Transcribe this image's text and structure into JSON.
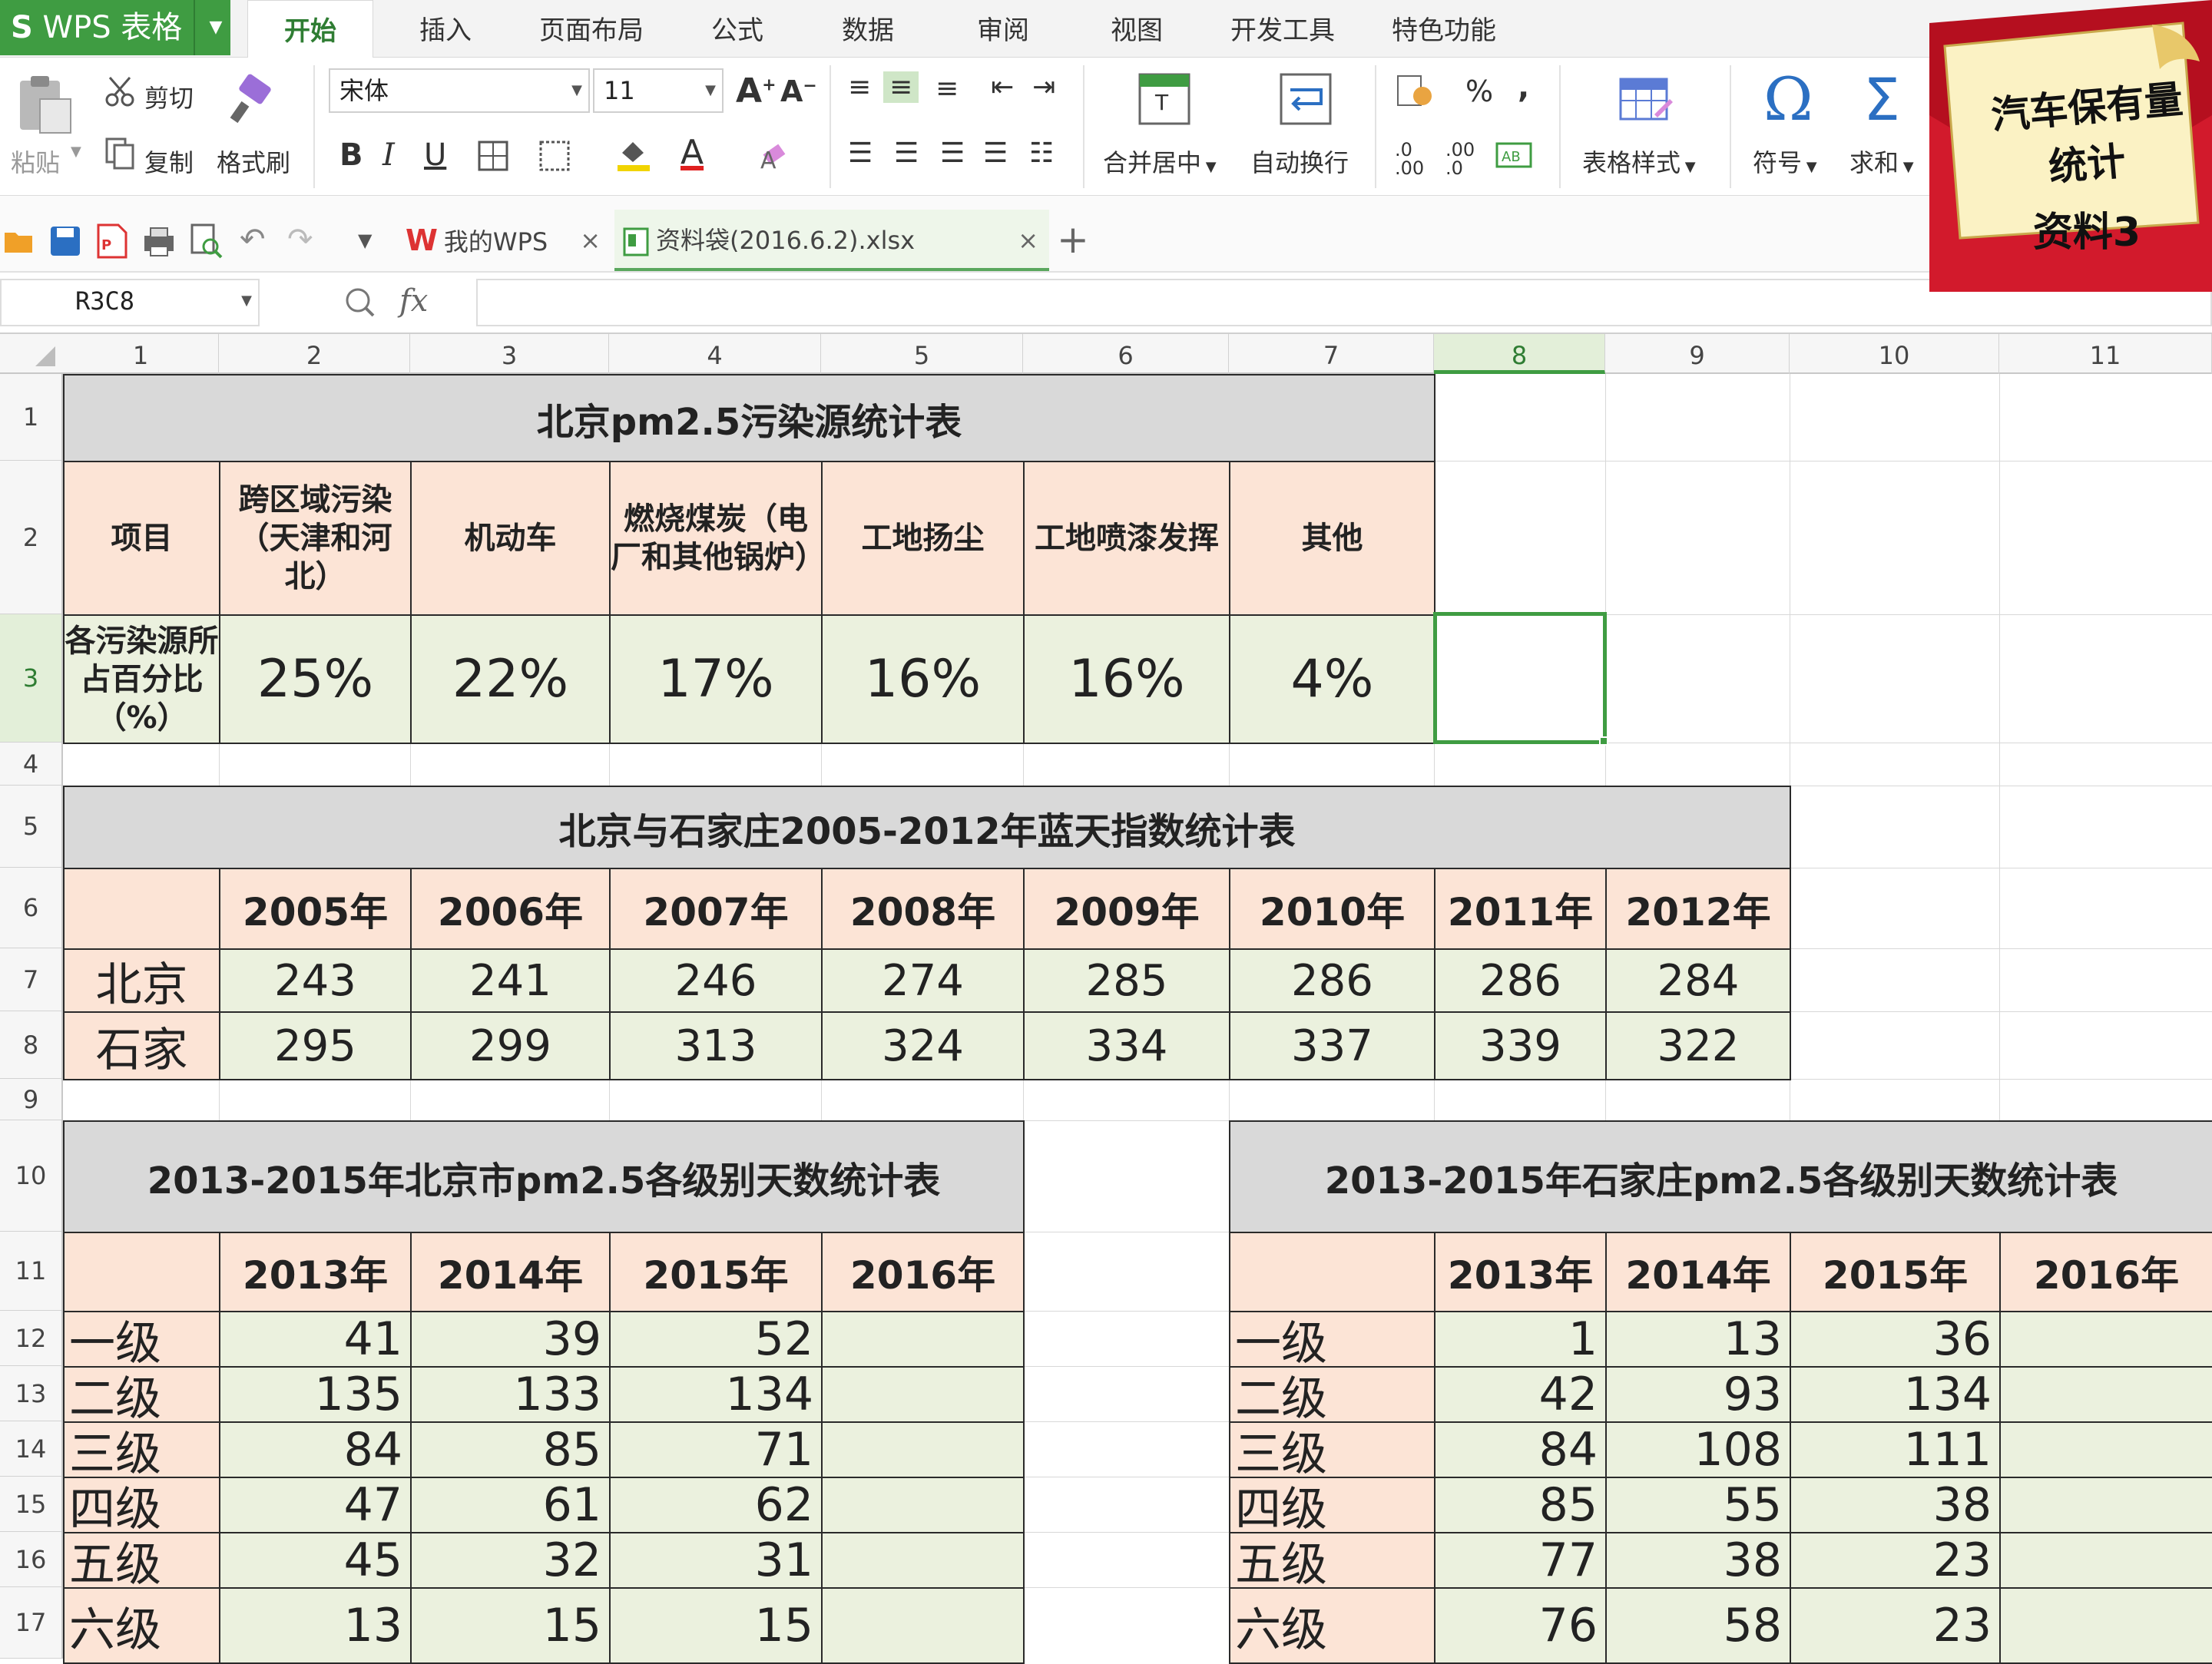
{
  "app": {
    "title": "WPS 表格"
  },
  "ribbon_tabs": [
    "开始",
    "插入",
    "页面布局",
    "公式",
    "数据",
    "审阅",
    "视图",
    "开发工具",
    "特色功能"
  ],
  "toolbar": {
    "paste": "粘贴",
    "cut": "剪切",
    "copy": "复制",
    "format_painter": "格式刷",
    "font_name": "宋体",
    "font_size": "11",
    "merge_center": "合并居中",
    "wrap": "自动换行",
    "table_style": "表格样式",
    "symbol": "符号",
    "sum": "求和",
    "percent": "%",
    "comma": ","
  },
  "doc_tabs": [
    {
      "label": "我的WPS",
      "active": false
    },
    {
      "label": "资料袋(2016.6.2).xlsx",
      "active": true
    }
  ],
  "formula_bar": {
    "cell_ref": "R3C8",
    "fx": "fx",
    "value": ""
  },
  "columns": [
    "1",
    "2",
    "3",
    "4",
    "5",
    "6",
    "7",
    "8",
    "9",
    "10",
    "11"
  ],
  "rows": [
    "1",
    "2",
    "3",
    "4",
    "5",
    "6",
    "7",
    "8",
    "9",
    "10",
    "11",
    "12",
    "13",
    "14",
    "15",
    "16",
    "17"
  ],
  "selected_cell": {
    "row": "3",
    "col": "8"
  },
  "sticker": {
    "line1": "汽车保有量",
    "line2": "统计",
    "line3": "资料3"
  },
  "table1": {
    "title": "北京pm2.5污染源统计表",
    "header_label": "项目",
    "headers": [
      "跨区域污染（天津和河北）",
      "机动车",
      "燃烧煤炭（电厂和其他锅炉）",
      "工地扬尘",
      "工地喷漆发挥",
      "其他"
    ],
    "row_label": "各污染源所占百分比（%）",
    "values": [
      "25%",
      "22%",
      "17%",
      "16%",
      "16%",
      "4%"
    ]
  },
  "table2": {
    "title": "北京与石家庄2005-2012年蓝天指数统计表",
    "years": [
      "2005年",
      "2006年",
      "2007年",
      "2008年",
      "2009年",
      "2010年",
      "2011年",
      "2012年"
    ],
    "rows": [
      {
        "city": "北京",
        "values": [
          "243",
          "241",
          "246",
          "274",
          "285",
          "286",
          "286",
          "284"
        ]
      },
      {
        "city": "石家",
        "values": [
          "295",
          "299",
          "313",
          "324",
          "334",
          "337",
          "339",
          "322"
        ]
      }
    ]
  },
  "table3": {
    "title": "2013-2015年北京市pm2.5各级别天数统计表",
    "years": [
      "2013年",
      "2014年",
      "2015年",
      "2016年"
    ],
    "rows": [
      {
        "level": "一级",
        "values": [
          "41",
          "39",
          "52",
          ""
        ]
      },
      {
        "level": "二级",
        "values": [
          "135",
          "133",
          "134",
          ""
        ]
      },
      {
        "level": "三级",
        "values": [
          "84",
          "85",
          "71",
          ""
        ]
      },
      {
        "level": "四级",
        "values": [
          "47",
          "61",
          "62",
          ""
        ]
      },
      {
        "level": "五级",
        "values": [
          "45",
          "32",
          "31",
          ""
        ]
      },
      {
        "level": "六级",
        "values": [
          "13",
          "15",
          "15",
          ""
        ]
      }
    ]
  },
  "table4": {
    "title": "2013-2015年石家庄pm2.5各级别天数统计表",
    "years": [
      "2013年",
      "2014年",
      "2015年",
      "2016年"
    ],
    "rows": [
      {
        "level": "一级",
        "values": [
          "1",
          "13",
          "36",
          ""
        ]
      },
      {
        "level": "二级",
        "values": [
          "42",
          "93",
          "134",
          ""
        ]
      },
      {
        "level": "三级",
        "values": [
          "84",
          "108",
          "111",
          ""
        ]
      },
      {
        "level": "四级",
        "values": [
          "85",
          "55",
          "38",
          ""
        ]
      },
      {
        "level": "五级",
        "values": [
          "77",
          "38",
          "23",
          ""
        ]
      },
      {
        "level": "六级",
        "values": [
          "76",
          "58",
          "23",
          ""
        ]
      }
    ]
  },
  "colors": {
    "accent": "#3f9c42",
    "header_grey": "#d9d9d9",
    "header_peach": "#fce4d6",
    "data_green": "#ebf1de",
    "sticker_red": "#c8102e"
  }
}
